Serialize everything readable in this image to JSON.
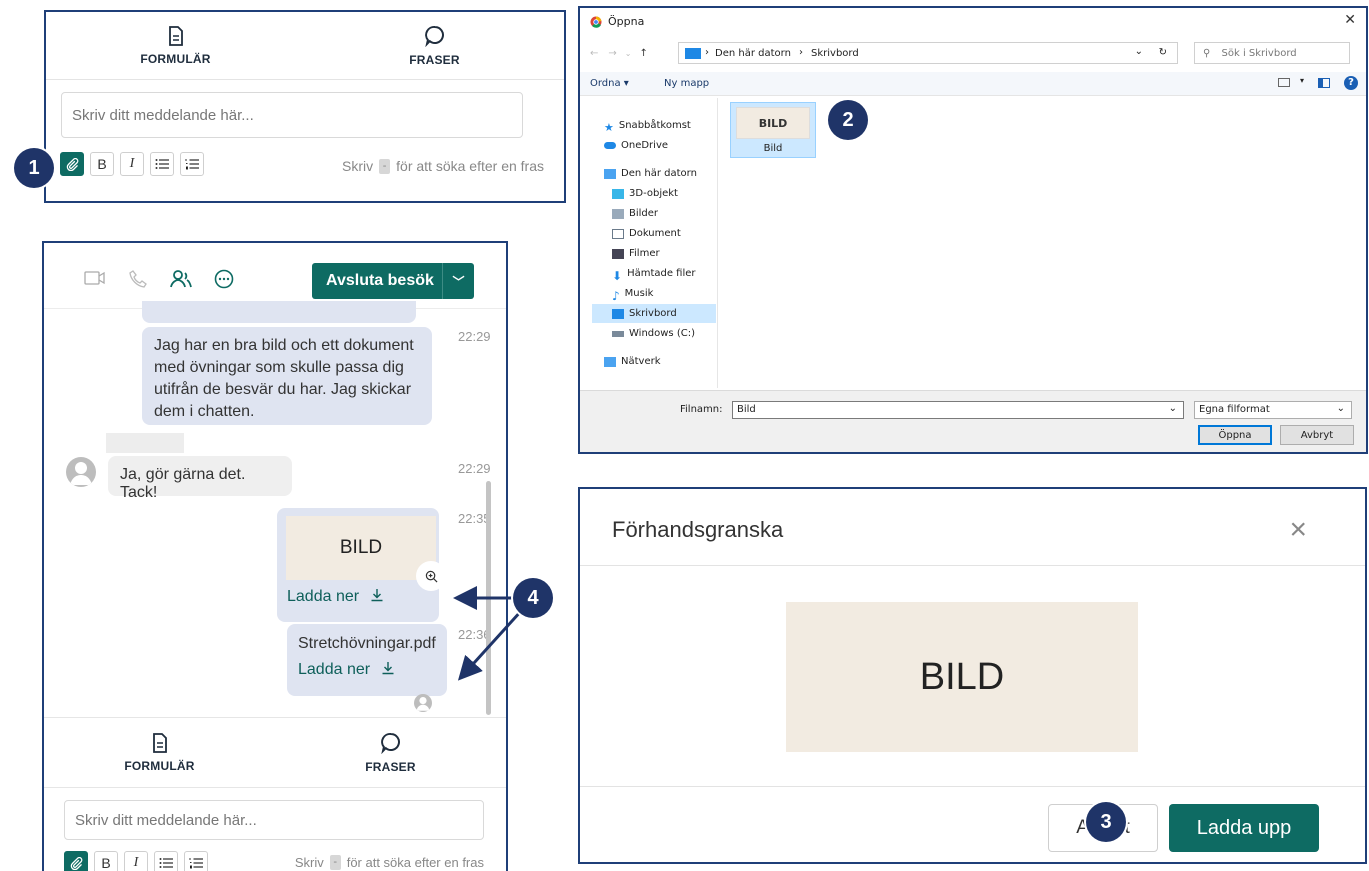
{
  "composer_top": {
    "tabs": [
      {
        "label": "FORMULÄR",
        "icon": "document-icon"
      },
      {
        "label": "FRASER",
        "icon": "speech-bubble-icon"
      }
    ],
    "placeholder": "Skriv ditt meddelande här...",
    "toolbar": {
      "bold": "B",
      "italic": "I",
      "bullets": "≡",
      "numbered": "≣"
    },
    "hint_prefix": "Skriv",
    "hint_key": "-",
    "hint_suffix": "för att söka efter en fras"
  },
  "badges": {
    "one": "1",
    "two": "2",
    "three": "3",
    "four": "4"
  },
  "chat": {
    "end_visit": "Avsluta besök",
    "messages": [
      {
        "text": "Jag har en bra bild och ett dokument med övningar som skulle passa dig utifrån de besvär du har. Jag skickar dem i chatten.",
        "time": "22:29"
      },
      {
        "text": "Ja, gör gärna det. Tack!",
        "time": "22:29"
      },
      {
        "image_label": "BILD",
        "link": "Ladda ner",
        "time": "22:35"
      },
      {
        "file": "Stretchövningar.pdf",
        "link": "Ladda ner",
        "time": "22:36"
      }
    ],
    "composer": {
      "tabs": [
        "FORMULÄR",
        "FRASER"
      ],
      "placeholder": "Skriv ditt meddelande här...",
      "hint_prefix": "Skriv",
      "hint_key": "-",
      "hint_suffix": "för att söka efter en fras"
    }
  },
  "file_dialog": {
    "title": "Öppna",
    "breadcrumb": [
      "Den här datorn",
      "Skrivbord"
    ],
    "search_placeholder": "Sök i Skrivbord",
    "organize": "Ordna ▾",
    "new_folder": "Ny mapp",
    "nav": [
      "Snabbåtkomst",
      "OneDrive",
      "Den här datorn",
      "3D-objekt",
      "Bilder",
      "Dokument",
      "Filmer",
      "Hämtade filer",
      "Musik",
      "Skrivbord",
      "Windows (C:)",
      "Nätverk"
    ],
    "file": {
      "thumb": "BILD",
      "name": "Bild"
    },
    "filename_label": "Filnamn:",
    "filename_value": "Bild",
    "filetype": "Egna filformat",
    "open": "Öppna",
    "cancel": "Avbryt"
  },
  "preview": {
    "title": "Förhandsgranska",
    "image_label": "BILD",
    "cancel": "Avbryt",
    "upload": "Ladda upp"
  },
  "colors": {
    "accent": "#0e6b63",
    "badge": "#1f3468",
    "frame": "#1f3f78"
  }
}
